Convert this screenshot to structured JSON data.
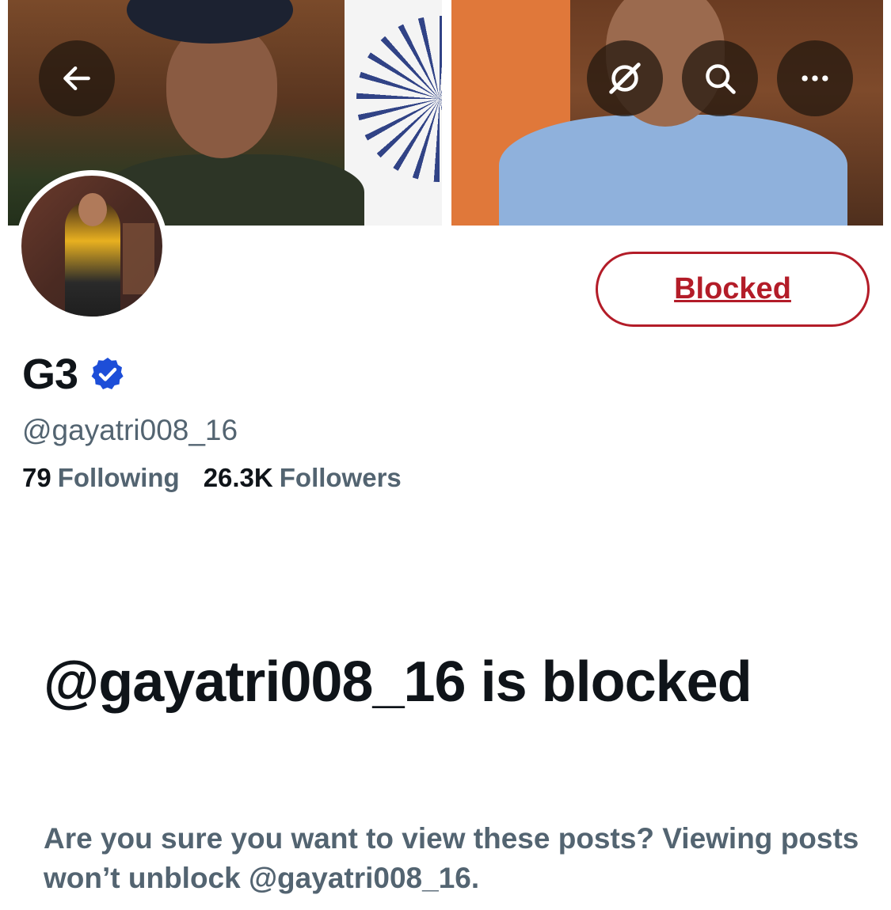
{
  "header": {
    "back_icon": "arrow-left-icon",
    "grok_icon": "grok-icon",
    "search_icon": "search-icon",
    "more_icon": "more-horizontal-icon"
  },
  "profile": {
    "display_name": "G3",
    "verified_icon": "verified-badge-icon",
    "handle": "@gayatri008_16",
    "following_count": "79",
    "following_label": "Following",
    "followers_count": "26.3K",
    "followers_label": "Followers",
    "action_button_label": "Blocked"
  },
  "blocked_notice": {
    "title": "@gayatri008_16 is blocked",
    "description": "Are you sure you want to view these posts? Viewing posts won’t unblock @gayatri008_16."
  },
  "colors": {
    "blocked_red": "#b31c28",
    "verified_blue": "#1d4ed8",
    "secondary_text": "#536471",
    "primary_text": "#0f1419"
  }
}
